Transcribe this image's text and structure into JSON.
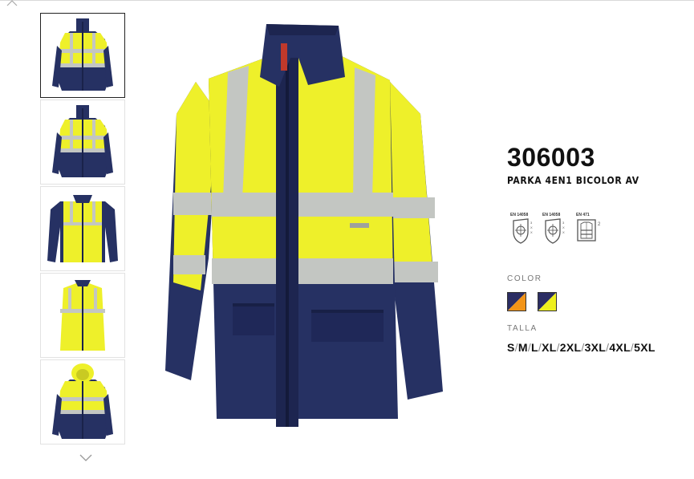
{
  "product": {
    "reference": "306003",
    "name": "PARKA 4EN1 BICOLOR AV"
  },
  "gallery": {
    "thumbnails": [
      {
        "label": "thumb-parka-front",
        "active": true
      },
      {
        "label": "thumb-parka-front-alt",
        "active": false
      },
      {
        "label": "thumb-inner-jacket",
        "active": false
      },
      {
        "label": "thumb-vest",
        "active": false
      },
      {
        "label": "thumb-parka-hood",
        "active": false
      }
    ]
  },
  "certifications": [
    {
      "code": "EN 14058",
      "icon": "thermometer-shield-icon"
    },
    {
      "code": "EN 14058",
      "icon": "thermometer-shield-icon"
    },
    {
      "code": "EN 471",
      "icon": "hi-vis-jacket-icon",
      "class": "2"
    }
  ],
  "color": {
    "label": "COLOR",
    "options": [
      {
        "name": "navy-orange",
        "a": "#2b2d63",
        "b": "#f29418"
      },
      {
        "name": "navy-yellow",
        "a": "#2b2d63",
        "b": "#eef01e"
      }
    ]
  },
  "size": {
    "label": "TALLA",
    "options": [
      "S",
      "M",
      "L",
      "XL",
      "2XL",
      "3XL",
      "4XL",
      "5XL"
    ]
  },
  "colors": {
    "navy": "#263163",
    "yellow": "#f0ef2a",
    "reflective": "#c3c6c2"
  }
}
